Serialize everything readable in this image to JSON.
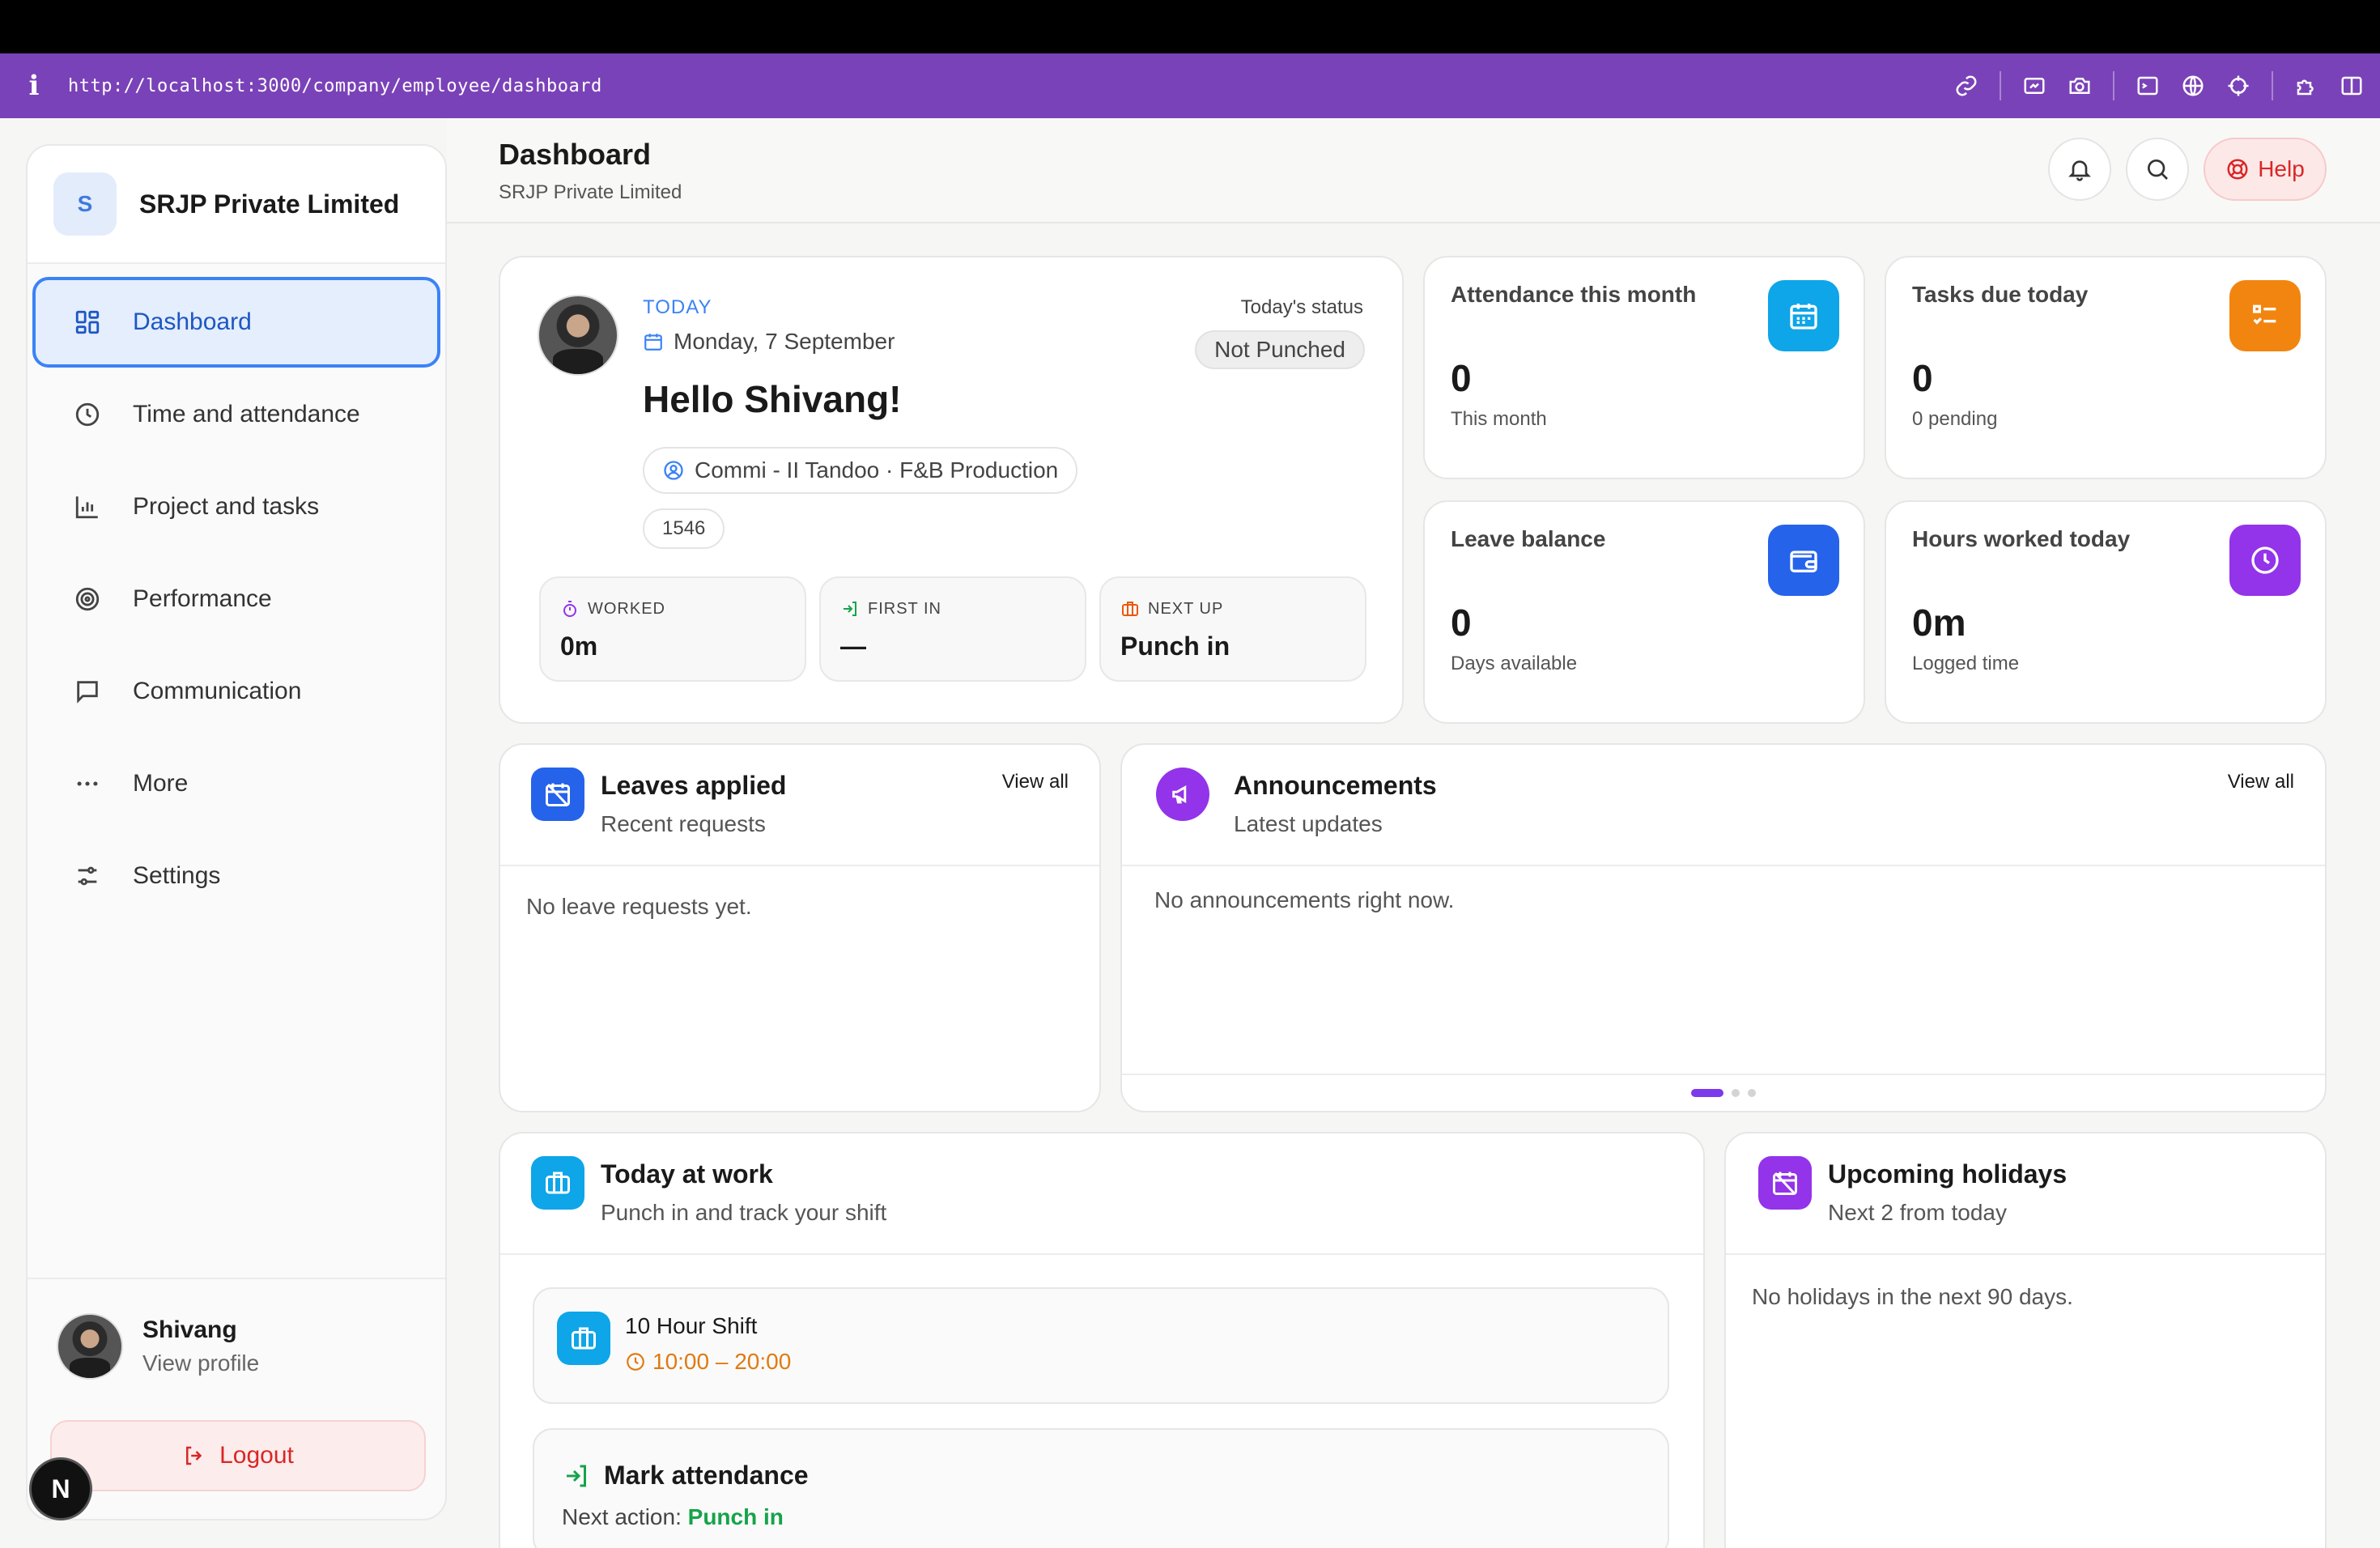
{
  "browser": {
    "url": "http://localhost:3000/company/employee/dashboard",
    "info_icon": "info-icon",
    "tools": [
      "link-icon",
      "screenshot-icon",
      "camera-icon",
      "terminal-icon",
      "globe-icon",
      "crosshair-icon",
      "puzzle-icon",
      "sidebar-toggle-icon"
    ]
  },
  "sidebar": {
    "brand_initial": "S",
    "brand_name": "SRJP Private Limited",
    "items": [
      {
        "label": "Dashboard",
        "icon": "grid-icon",
        "active": true
      },
      {
        "label": "Time and attendance",
        "icon": "clock-icon"
      },
      {
        "label": "Project and tasks",
        "icon": "chart-icon"
      },
      {
        "label": "Performance",
        "icon": "target-icon"
      },
      {
        "label": "Communication",
        "icon": "message-icon"
      },
      {
        "label": "More",
        "icon": "ellipsis-icon"
      },
      {
        "label": "Settings",
        "icon": "sliders-icon"
      }
    ],
    "profile": {
      "name": "Shivang",
      "sub": "View profile"
    },
    "logout_label": "Logout",
    "dev_badge": "N"
  },
  "header": {
    "title": "Dashboard",
    "subtitle": "SRJP Private Limited",
    "help_label": "Help"
  },
  "hero": {
    "today_label": "TODAY",
    "date": "Monday, 7 September",
    "greeting": "Hello Shivang!",
    "role": "Commi - II Tandoo · F&B Production",
    "employee_id": "1546",
    "status_label": "Today's status",
    "status_value": "Not Punched",
    "minis": [
      {
        "label": "WORKED",
        "value": "0m",
        "icon": "stopwatch-icon",
        "color": "#9333ea"
      },
      {
        "label": "FIRST IN",
        "value": "—",
        "icon": "login-icon",
        "color": "#16a34a"
      },
      {
        "label": "NEXT UP",
        "value": "Punch in",
        "icon": "briefcase-icon",
        "color": "#ea580c"
      }
    ]
  },
  "stats": [
    {
      "title": "Attendance this month",
      "value": "0",
      "sub": "This month",
      "icon": "calendar-icon",
      "color": "#0ea5e9"
    },
    {
      "title": "Tasks due today",
      "value": "0",
      "sub": "0 pending",
      "icon": "checklist-icon",
      "color": "#f2850f"
    },
    {
      "title": "Leave balance",
      "value": "0",
      "sub": "Days available",
      "icon": "wallet-icon",
      "color": "#2563eb"
    },
    {
      "title": "Hours worked today",
      "value": "0m",
      "sub": "Logged time",
      "icon": "clock-icon",
      "color": "#9333ea"
    }
  ],
  "leaves": {
    "title": "Leaves applied",
    "sub": "Recent requests",
    "link": "View all",
    "empty": "No leave requests yet.",
    "color": "#2563eb"
  },
  "announcements": {
    "title": "Announcements",
    "sub": "Latest updates",
    "link": "View all",
    "empty": "No announcements right now.",
    "color": "#9333ea",
    "page_count": 3,
    "active_page": 1
  },
  "today_work": {
    "title": "Today at work",
    "sub": "Punch in and track your shift",
    "color": "#0ea5e9",
    "shift_name": "10 Hour Shift",
    "shift_time": "10:00 – 20:00",
    "mark_title": "Mark attendance",
    "mark_prefix": "Next action:",
    "mark_action": "Punch in"
  },
  "holidays": {
    "title": "Upcoming holidays",
    "sub": "Next 2 from today",
    "empty": "No holidays in the next 90 days.",
    "color": "#9333ea"
  }
}
